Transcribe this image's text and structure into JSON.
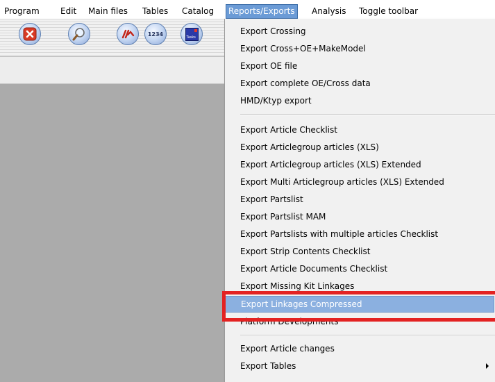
{
  "menubar": {
    "items": [
      "Program",
      "Edit",
      "Main files",
      "Tables",
      "Catalog",
      "Reports/Exports",
      "Analysis",
      "Toggle toolbar"
    ],
    "active_index": 5
  },
  "toolbar": {
    "buttons": [
      "close-icon",
      "search-icon",
      "crossing-icon",
      "numbers-icon",
      "tasks-icon"
    ],
    "numbers_label": "1234",
    "tasks_label": "Tasks"
  },
  "dropdown": {
    "items": [
      "Export Crossing",
      "Export Cross+OE+MakeModel",
      "Export OE file",
      "Export complete OE/Cross data",
      "HMD/Ktyp export",
      "Export Article Checklist",
      "Export Articlegroup articles (XLS)",
      "Export Articlegroup articles (XLS) Extended",
      "Export Multi Articlegroup articles (XLS) Extended",
      "Export Partslist",
      "Export Partslist MAM",
      "Export Partslists with multiple articles Checklist",
      "Export Strip Contents Checklist",
      "Export Article Documents Checklist",
      "Export Missing Kit Linkages",
      "Export Linkages Compressed",
      "Platform Developments",
      "Export Article changes",
      "Export Tables"
    ],
    "highlighted_index": 15
  },
  "colors": {
    "menu_active": "#6b9bd6",
    "highlight": "#8bb0e0",
    "annotation_frame": "#e32222"
  }
}
